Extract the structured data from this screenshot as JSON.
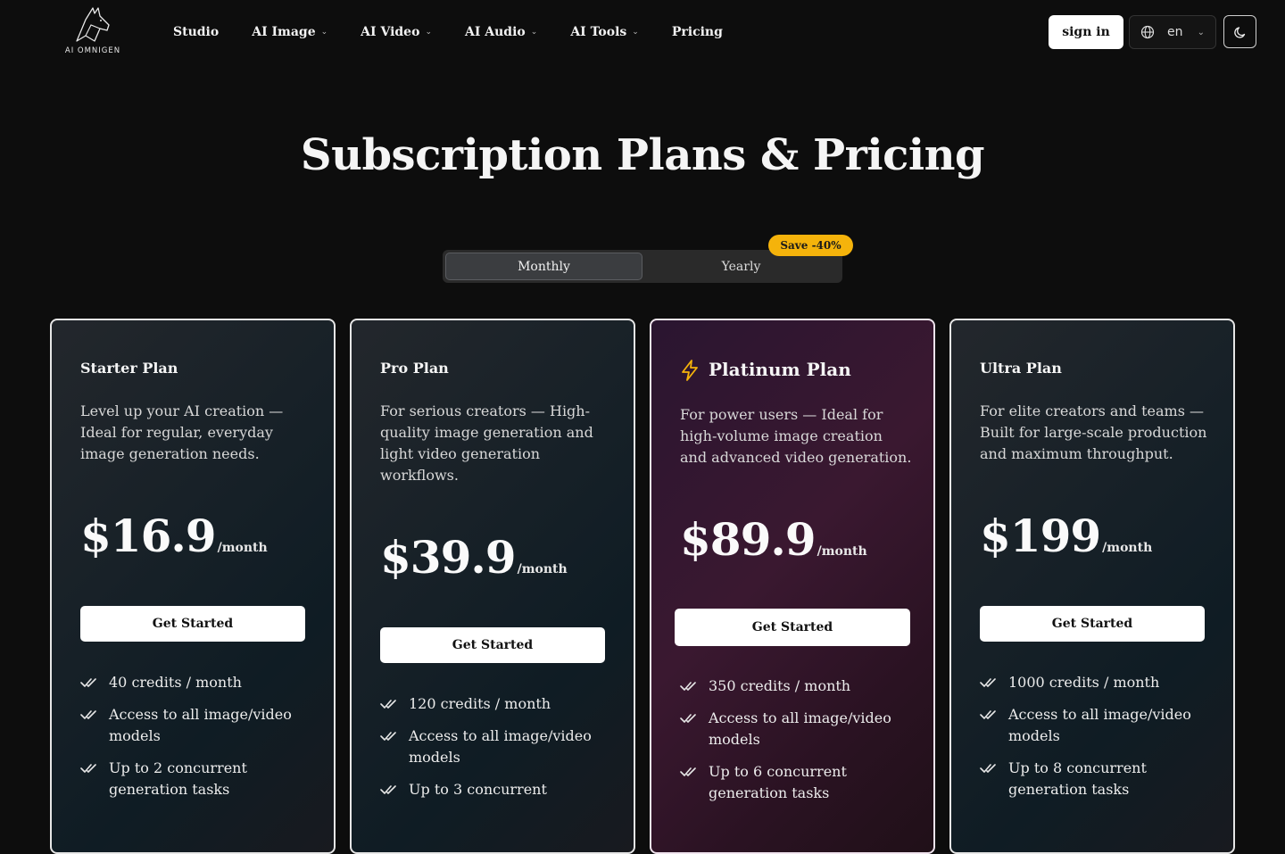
{
  "nav": {
    "logo_text": "AI OMNIGEN",
    "links": [
      {
        "label": "Studio",
        "dropdown": false
      },
      {
        "label": "AI Image",
        "dropdown": true
      },
      {
        "label": "AI Video",
        "dropdown": true
      },
      {
        "label": "AI Audio",
        "dropdown": true
      },
      {
        "label": "AI Tools",
        "dropdown": true
      },
      {
        "label": "Pricing",
        "dropdown": false
      }
    ],
    "signin_label": "sign in",
    "language": "en"
  },
  "header": {
    "title": "Subscription Plans & Pricing",
    "billing": {
      "monthly": "Monthly",
      "yearly": "Yearly",
      "selected": "Monthly",
      "save_badge": "Save -40%"
    }
  },
  "plans": [
    {
      "name": "Starter Plan",
      "description": "Level up your AI creation — Ideal for regular, everyday image generation needs.",
      "price": "$16.9",
      "period": "/month",
      "cta": "Get Started",
      "features": [
        "40 credits / month",
        "Access to all image/video models",
        "Up to 2 concurrent generation tasks"
      ]
    },
    {
      "name": "Pro Plan",
      "description": "For serious creators — High-quality image generation and light video generation workflows.",
      "price": "$39.9",
      "period": "/month",
      "cta": "Get Started",
      "features": [
        "120 credits / month",
        "Access to all image/video models",
        "Up to 3 concurrent"
      ]
    },
    {
      "name": "Platinum Plan",
      "description": "For power users — Ideal for high-volume image creation and advanced video generation.",
      "price": "$89.9",
      "period": "/month",
      "cta": "Get Started",
      "features": [
        "350 credits / month",
        "Access to all image/video models",
        "Up to 6 concurrent generation tasks"
      ]
    },
    {
      "name": "Ultra Plan",
      "description": "For elite creators and teams — Built for large-scale production and maximum throughput.",
      "price": "$199",
      "period": "/month",
      "cta": "Get Started",
      "features": [
        "1000 credits / month",
        "Access to all image/video models",
        "Up to 8 concurrent generation tasks"
      ]
    }
  ],
  "colors": {
    "accent_badge": "#f5b30b",
    "bolt": "#f5b30b",
    "background": "#0d0d0d"
  }
}
